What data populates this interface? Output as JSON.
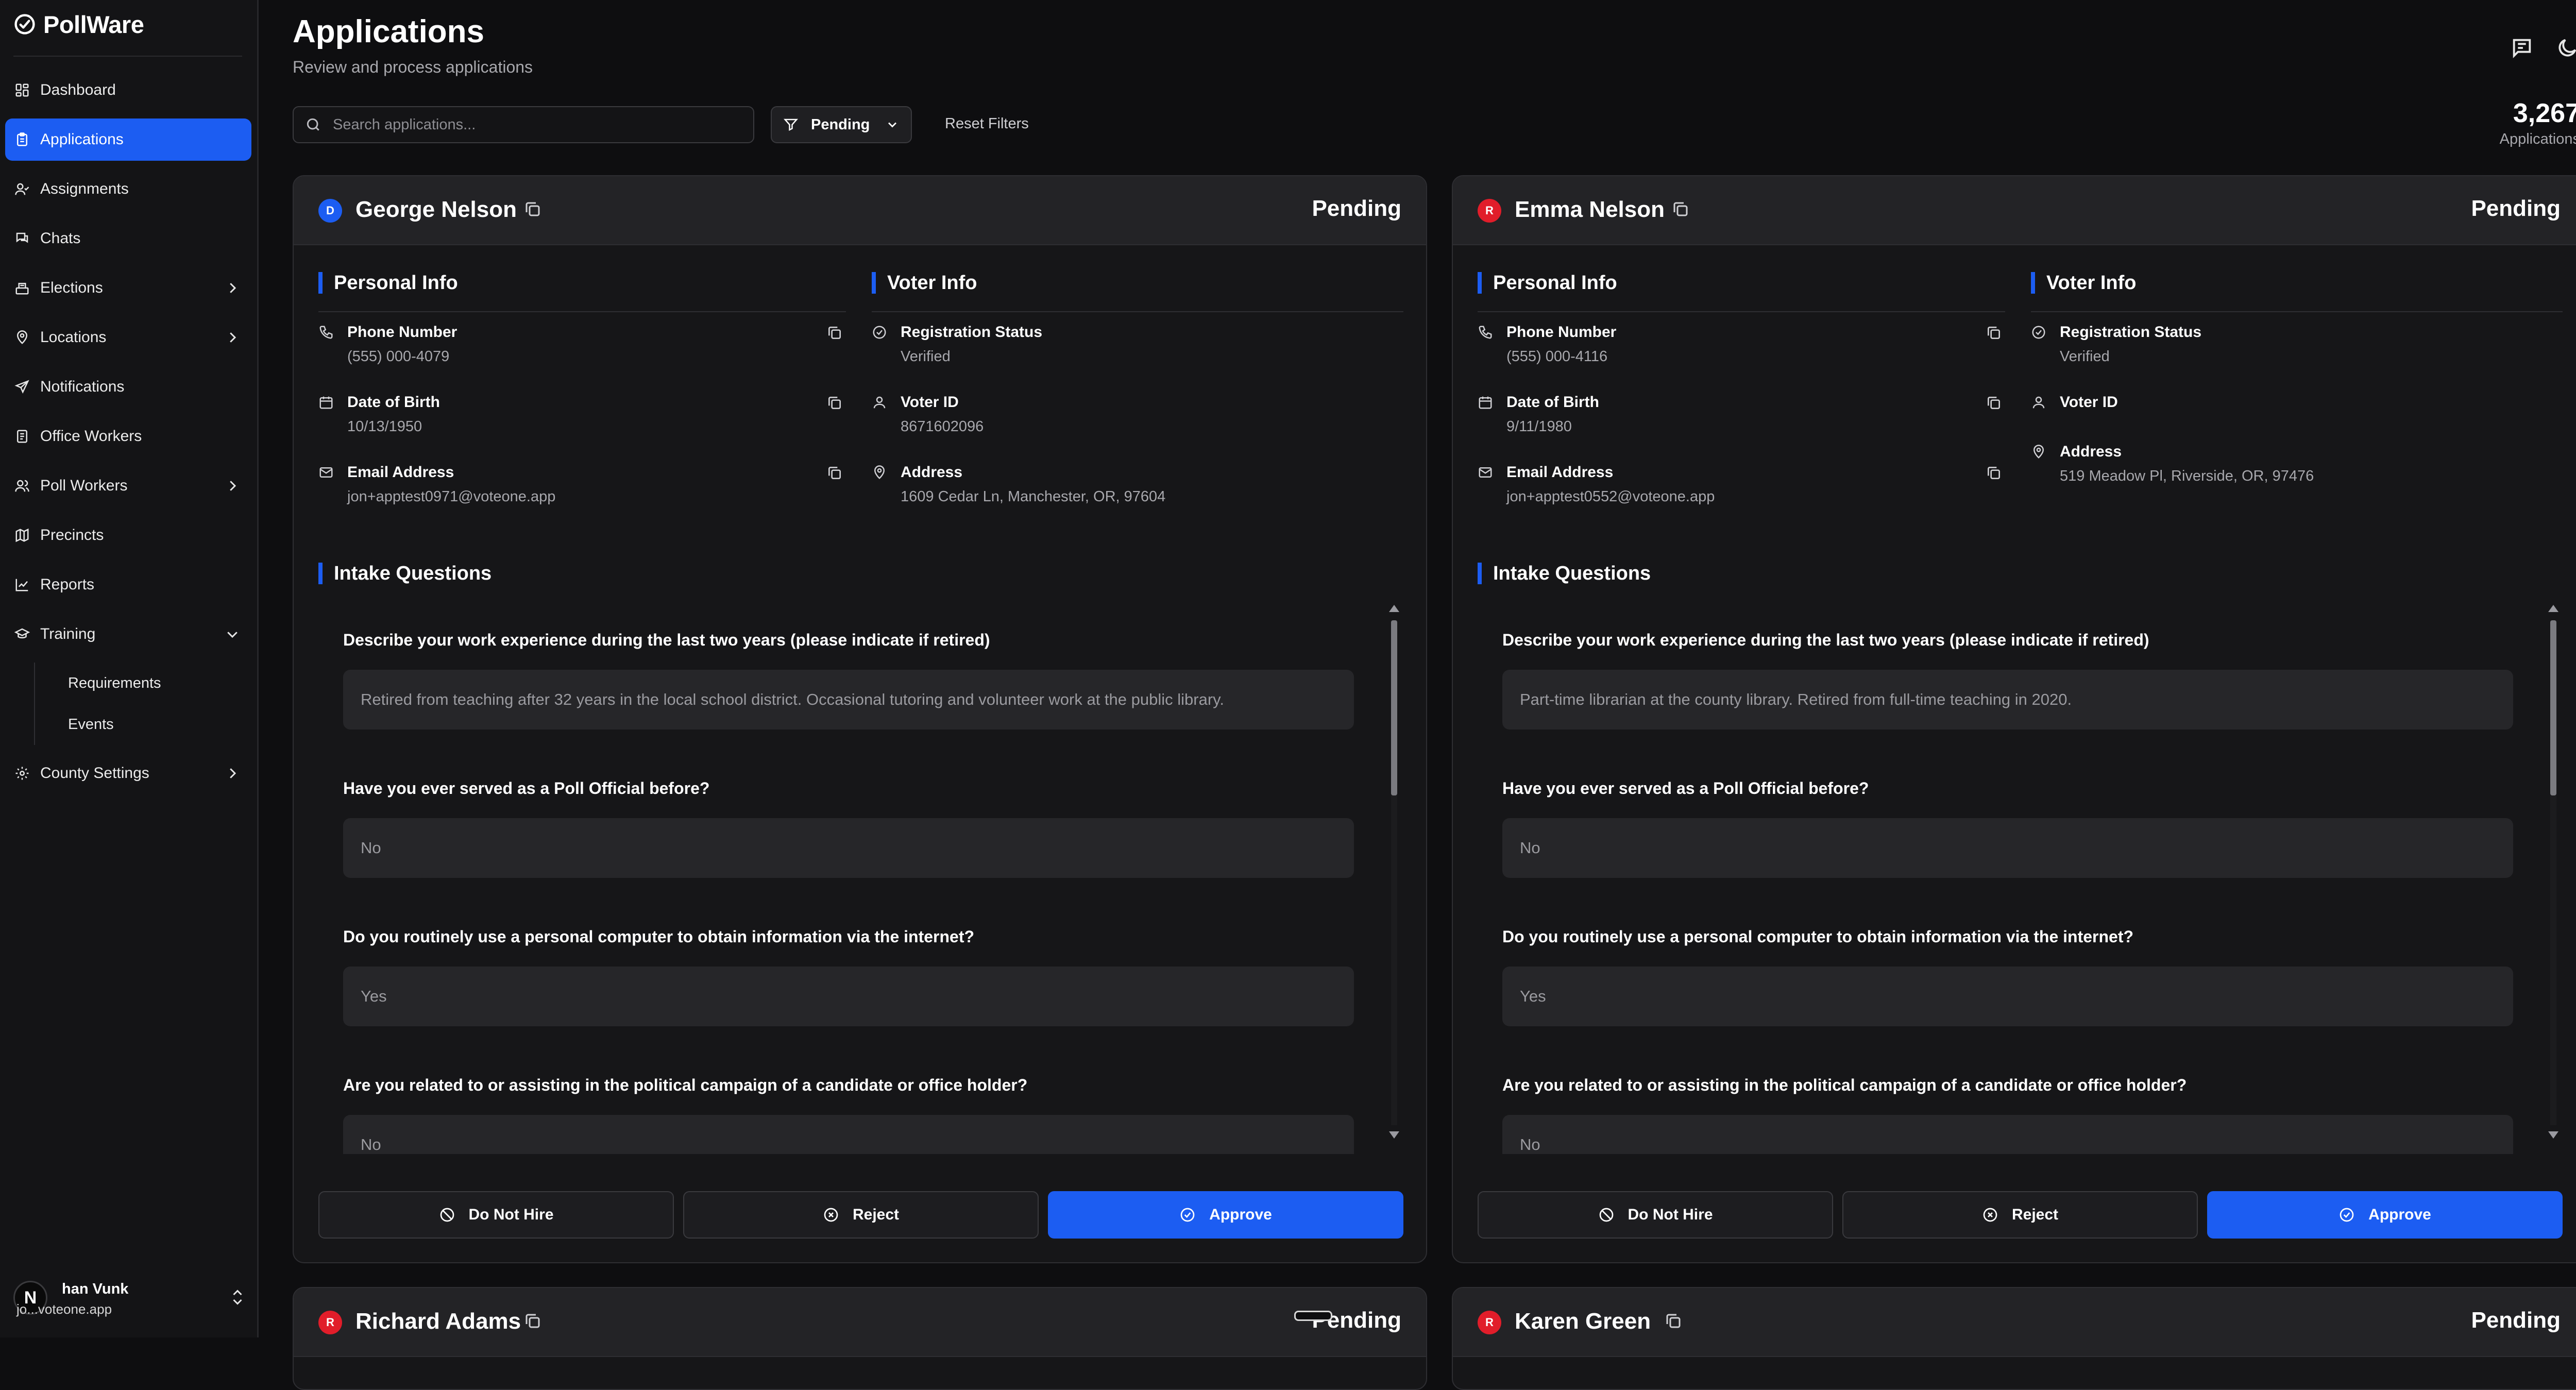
{
  "app": {
    "name": "PollWare"
  },
  "sidebar": {
    "items": [
      {
        "label": "Dashboard",
        "icon": "dashboard-icon"
      },
      {
        "label": "Applications",
        "icon": "clipboard-icon",
        "active": true
      },
      {
        "label": "Assignments",
        "icon": "user-check-icon"
      },
      {
        "label": "Chats",
        "icon": "chat-icon"
      },
      {
        "label": "Elections",
        "icon": "ballot-icon",
        "expandable": true
      },
      {
        "label": "Locations",
        "icon": "map-pin-icon",
        "expandable": true
      },
      {
        "label": "Notifications",
        "icon": "send-icon"
      },
      {
        "label": "Office Workers",
        "icon": "badge-icon"
      },
      {
        "label": "Poll Workers",
        "icon": "users-icon",
        "expandable": true
      },
      {
        "label": "Precincts",
        "icon": "map-icon"
      },
      {
        "label": "Reports",
        "icon": "chart-icon"
      },
      {
        "label": "Training",
        "icon": "graduation-cap-icon",
        "expanded": true
      },
      {
        "label": "Requirements",
        "sub": true
      },
      {
        "label": "Events",
        "sub": true
      },
      {
        "label": "County Settings",
        "icon": "settings-icon",
        "expandable": true
      }
    ]
  },
  "user": {
    "avatar_initial": "N",
    "name": "han Vunk",
    "email": "jo...voteone.app"
  },
  "header": {
    "title": "Applications",
    "subtitle": "Review and process applications",
    "search_placeholder": "Search applications...",
    "filter_label": "Pending",
    "reset_label": "Reset Filters",
    "count": "3,267",
    "count_label": "Applications"
  },
  "colors": {
    "accent": "#1c5df2",
    "democrat": "#1c5df2",
    "republican": "#e11d2a"
  },
  "cards": [
    {
      "name": "George Nelson",
      "party": "D",
      "status": "Pending",
      "personal_heading": "Personal Info",
      "voter_heading": "Voter Info",
      "phone_label": "Phone Number",
      "phone": "(555) 000-4079",
      "dob_label": "Date of Birth",
      "dob": "10/13/1950",
      "email_label": "Email Address",
      "email": "jon+apptest0971@voteone.app",
      "reg_label": "Registration Status",
      "reg": "Verified",
      "voterid_label": "Voter ID",
      "voterid": "8671602096",
      "address_label": "Address",
      "address": "1609 Cedar Ln, Manchester, OR, 97604",
      "intake_heading": "Intake Questions",
      "questions": [
        {
          "q": "Describe your work experience during the last two years (please indicate if retired)",
          "a": "Retired from teaching after 32 years in the local school district. Occasional tutoring and volunteer work at the public library."
        },
        {
          "q": "Have you ever served as a Poll Official before?",
          "a": "No"
        },
        {
          "q": "Do you routinely use a personal computer to obtain information via the internet?",
          "a": "Yes"
        },
        {
          "q": "Are you related to or assisting in the political campaign of a candidate or office holder?",
          "a": "No"
        }
      ],
      "actions": {
        "dnh": "Do Not Hire",
        "reject": "Reject",
        "approve": "Approve"
      }
    },
    {
      "name": "Emma Nelson",
      "party": "R",
      "status": "Pending",
      "personal_heading": "Personal Info",
      "voter_heading": "Voter Info",
      "phone_label": "Phone Number",
      "phone": "(555) 000-4116",
      "dob_label": "Date of Birth",
      "dob": "9/11/1980",
      "email_label": "Email Address",
      "email": "jon+apptest0552@voteone.app",
      "reg_label": "Registration Status",
      "reg": "Verified",
      "voterid_label": "Voter ID",
      "voterid": "",
      "address_label": "Address",
      "address": "519 Meadow Pl, Riverside, OR, 97476",
      "intake_heading": "Intake Questions",
      "questions": [
        {
          "q": "Describe your work experience during the last two years (please indicate if retired)",
          "a": "Part-time librarian at the county library. Retired from full-time teaching in 2020."
        },
        {
          "q": "Have you ever served as a Poll Official before?",
          "a": "No"
        },
        {
          "q": "Do you routinely use a personal computer to obtain information via the internet?",
          "a": "Yes"
        },
        {
          "q": "Are you related to or assisting in the political campaign of a candidate or office holder?",
          "a": "No"
        }
      ],
      "actions": {
        "dnh": "Do Not Hire",
        "reject": "Reject",
        "approve": "Approve"
      }
    },
    {
      "name": "Richard Adams",
      "party": "R",
      "status": "Pending"
    },
    {
      "name": "Karen Green",
      "party": "R",
      "status": "Pending"
    }
  ]
}
